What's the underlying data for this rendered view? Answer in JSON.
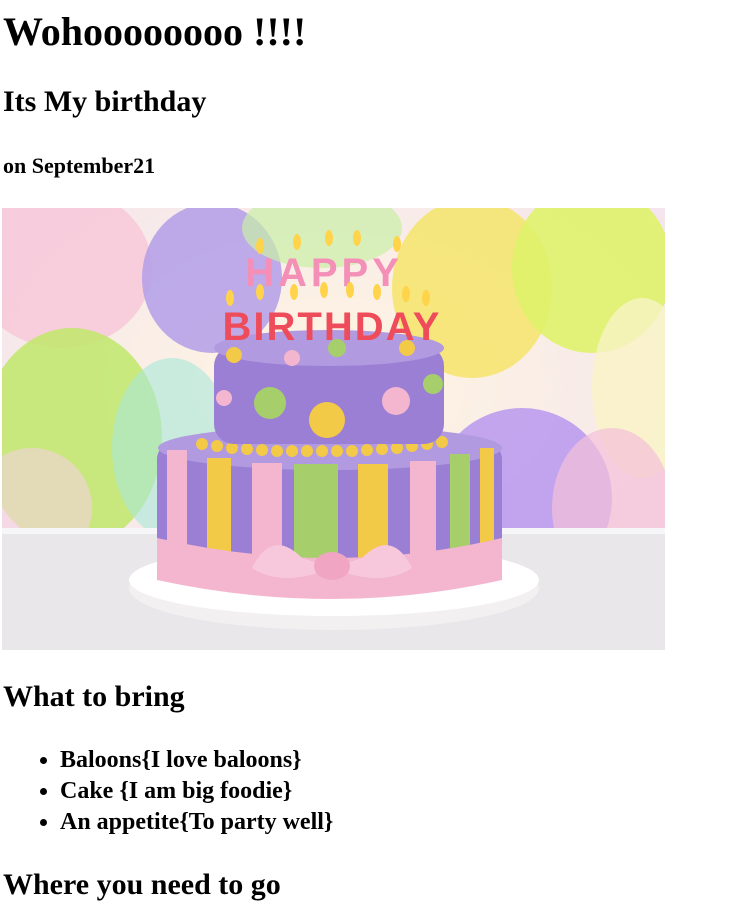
{
  "heading_main": "Wohoooooooo !!!!",
  "heading_sub": "Its My birthday",
  "heading_date": "on September21",
  "image": {
    "alt": "Birthday cake with HAPPY BIRTHDAY candles",
    "candle_top": "HAPPY",
    "candle_bottom": "BIRTHDAY"
  },
  "bring": {
    "title": "What to bring",
    "items": [
      "Baloons{I love baloons}",
      "Cake {I am big foodie}",
      "An appetite{To party well}"
    ]
  },
  "where": {
    "title": "Where you need to go"
  },
  "colors": {
    "text": "#000000",
    "background": "#ffffff",
    "cake_purple": "#9b7fd4",
    "cake_pink": "#f4b6cf",
    "cake_green": "#a6cf6b",
    "cake_yellow": "#f3c948"
  }
}
